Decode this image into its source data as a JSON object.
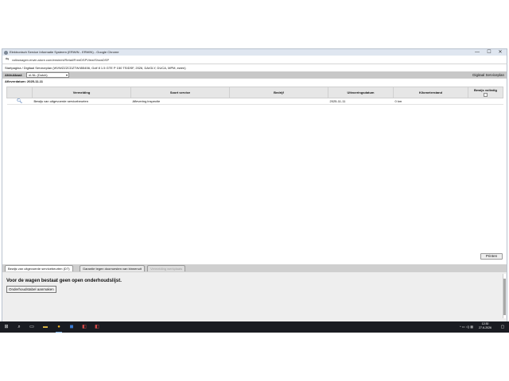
{
  "browser": {
    "window_title": "Elektronisch Service Informatie Systeem (ERWIN - ERWIN) - Google Chrome",
    "url": "volkswagen.erwin-store.com/erwin/nl/Retail/FreeDSPView/ShowDSP",
    "window_controls": [
      "—",
      "☐",
      "✕"
    ]
  },
  "breadcrumb": "Startpagina / Digitaal Serviceplan (WVWZZZCDZTW455456, Golf 8 1.5 GTE P 150 TSIDSF, 2026, DA/GLY, DUCA, MPM, ewen)",
  "toolbar": {
    "language_label": "Afdrukbaal:",
    "language_value": "nl-NL (Dutch)",
    "page_title": "Digitaal Serviceplan"
  },
  "date_line": "Afleverdatum: 2025-11-11",
  "table": {
    "columns": [
      "Vermelding",
      "Soort service",
      "Bedrijf",
      "Uitvoeringsdatum",
      "Kilometerstand",
      "Bewijs volledig"
    ],
    "rows": [
      {
        "vermelding": "Bewijs van uitgevoerde servicebeurten",
        "soort_service": "Aflevering inspectie",
        "bedrijf": "",
        "datum": "2025-11-11",
        "km": "0 km",
        "bewijs": ""
      }
    ]
  },
  "print_button": "Printen",
  "bottom_tabs": [
    {
      "label": "Bewijs van uitgevoerde servicebeurten (DT)",
      "state": "active"
    },
    {
      "label": "Garantie tegen doorroesten van binnenuit",
      "state": "normal"
    },
    {
      "label": "Vermelding werkplaats",
      "state": "disabled"
    }
  ],
  "bottom_panel": {
    "message": "Voor de wagen bestaat geen open onderhoudslijst.",
    "button": "Onderhoudstabel aanmaken"
  },
  "taskbar": {
    "time": "12:30",
    "date": "27-6-2026",
    "tray": "^ ▭ ◁) ▦"
  }
}
